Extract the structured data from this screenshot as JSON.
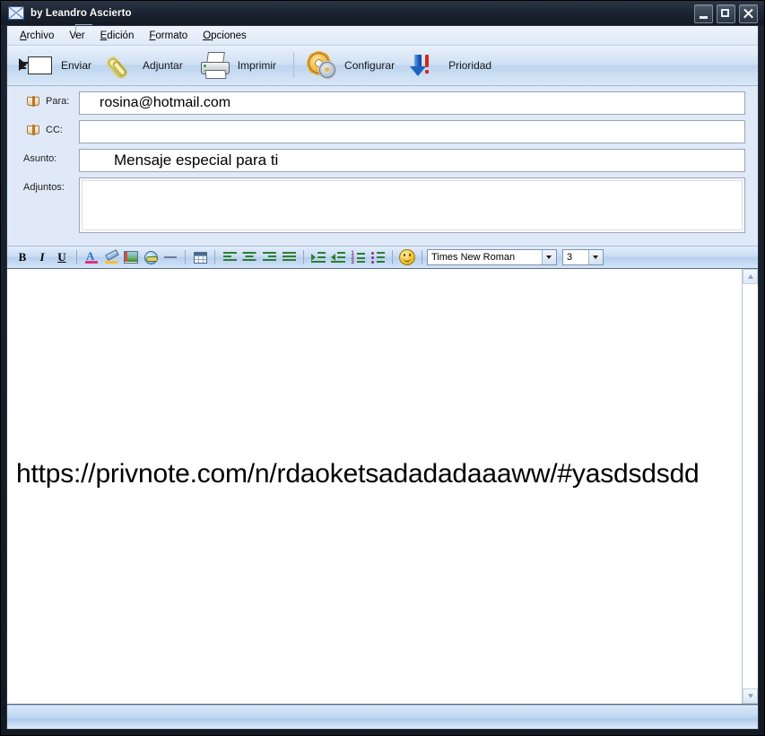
{
  "window": {
    "title": "by Leandro Ascierto",
    "icon": "envelope-icon",
    "minimize_label": "Minimizar",
    "maximize_label": "Maximizar",
    "close_label": "Cerrar"
  },
  "menu": {
    "items": [
      {
        "label": "Archivo",
        "accel": "A"
      },
      {
        "label": "Ver",
        "accel": ""
      },
      {
        "label": "Edición",
        "accel": "E"
      },
      {
        "label": "Formato",
        "accel": "F"
      },
      {
        "label": "Opciones",
        "accel": "O"
      }
    ]
  },
  "toolbar": {
    "buttons": [
      {
        "label": "Enviar",
        "icon": "send-mail-icon"
      },
      {
        "label": "Adjuntar",
        "icon": "paperclip-icon"
      },
      {
        "label": "Imprimir",
        "icon": "printer-icon"
      },
      {
        "label": "Configurar",
        "icon": "gears-icon"
      },
      {
        "label": "Prioridad",
        "icon": "priority-arrow-icon"
      }
    ]
  },
  "fields": {
    "to": {
      "label": "Para:",
      "value": "rosina@hotmail.com",
      "placeholder": "",
      "icon": "address-book-icon"
    },
    "cc": {
      "label": "CC:",
      "value": "",
      "placeholder": "",
      "icon": "address-book-icon"
    },
    "subject": {
      "label": "Asunto:",
      "value": "Mensaje especial para ti",
      "placeholder": ""
    },
    "attachments": {
      "label": "Adjuntos:",
      "value": ""
    }
  },
  "formatbar": {
    "bold": "B",
    "italic": "I",
    "underline": "U",
    "buttons": [
      {
        "name": "bold-button",
        "title": "Negrita"
      },
      {
        "name": "italic-button",
        "title": "Cursiva"
      },
      {
        "name": "underline-button",
        "title": "Subrayado"
      },
      {
        "name": "font-color-button",
        "title": "Color de fuente"
      },
      {
        "name": "highlight-button",
        "title": "Resaltar"
      },
      {
        "name": "insert-image-button",
        "title": "Insertar imagen"
      },
      {
        "name": "insert-link-button",
        "title": "Insertar enlace"
      },
      {
        "name": "horizontal-rule-button",
        "title": "Línea horizontal"
      },
      {
        "name": "insert-table-button",
        "title": "Insertar tabla"
      },
      {
        "name": "align-left-button",
        "title": "Alinear a la izquierda"
      },
      {
        "name": "align-center-button",
        "title": "Centrar"
      },
      {
        "name": "align-right-button",
        "title": "Alinear a la derecha"
      },
      {
        "name": "align-justify-button",
        "title": "Justificar"
      },
      {
        "name": "indent-increase-button",
        "title": "Aumentar sangría"
      },
      {
        "name": "indent-decrease-button",
        "title": "Disminuir sangría"
      },
      {
        "name": "numbered-list-button",
        "title": "Lista numerada"
      },
      {
        "name": "bulleted-list-button",
        "title": "Lista con viñetas"
      },
      {
        "name": "emoji-button",
        "title": "Emoticono"
      }
    ],
    "font": {
      "value": "Times New Roman",
      "options": [
        "Times New Roman"
      ]
    },
    "size": {
      "value": "3",
      "options": [
        "3"
      ]
    }
  },
  "body": {
    "text": "https://privnote.com/n/rdaoketsadadadaaaww/#yasdsdsdd"
  },
  "scrollbar": {
    "up_label": "Desplazar arriba",
    "down_label": "Desplazar abajo"
  },
  "colors": {
    "titlebar": "#1a2230",
    "client_bg": "#dfe9f7",
    "toolbar_top": "#e9f1fb",
    "accent_blue": "#1e63c4",
    "priority_red": "#d9261c",
    "editor_bg": "#ffffff"
  }
}
